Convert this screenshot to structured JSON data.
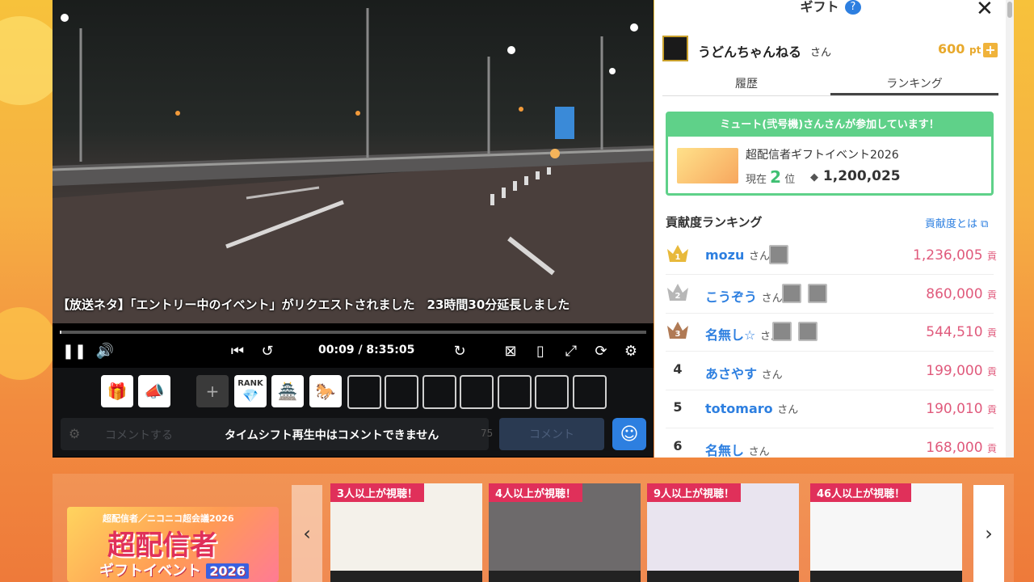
{
  "player": {
    "caption": "【放送ネタ】「エントリー中のイベント」がリクエストされました　23時間30分延長しました",
    "timecode": "00:09 / 8:35:05",
    "progress": 0.0003
  },
  "tools": {
    "rank_label": "RANK"
  },
  "comment": {
    "placeholder": "コメントする",
    "disabled_message": "タイムシフト再生中はコメントできません",
    "char_count": "75",
    "submit_label": "コメント"
  },
  "gift_panel": {
    "title": "ギフト",
    "user_name": "うどんちゃんねる",
    "user_suffix": "さん",
    "points": "600",
    "points_unit": "pt",
    "tabs": [
      "履歴",
      "ランキング"
    ],
    "active_tab": 1,
    "event_header": "ミュート(弐号機)さんさんが参加しています！",
    "event_name": "超配信者ギフトイベント2026",
    "event_rank_prefix": "現在",
    "event_rank": "2",
    "event_rank_suffix": "位",
    "event_score": "1,200,025",
    "contrib_title": "貢献度ランキング",
    "contrib_link": "貢献度とは",
    "score_unit": "貢",
    "rows": [
      {
        "rank": "1",
        "name": "mozu",
        "san": "さん",
        "score": "1,236,005"
      },
      {
        "rank": "2",
        "name": "こうぞう",
        "san": "さん",
        "score": "860,000"
      },
      {
        "rank": "3",
        "name": "名無し☆",
        "san": "さん",
        "score": "544,510"
      },
      {
        "rank": "4",
        "name": "あさやす",
        "san": "さん",
        "score": "199,000"
      },
      {
        "rank": "5",
        "name": "totomaro",
        "san": "さん",
        "score": "190,010"
      },
      {
        "rank": "6",
        "name": "名無し",
        "san": "さん",
        "score": "168,000"
      }
    ],
    "colors": {
      "accent": "#2d7fe0",
      "score": "#e05a7c",
      "event_green": "#5fd189",
      "points": "#e8a92c"
    }
  },
  "carousel": {
    "event_logo": {
      "line1": "超配信者／ニコニコ超会議2026",
      "line2": "超配信者",
      "line3": "ギフトイベント",
      "year": "2026"
    },
    "thumbs": [
      {
        "badge": "3人以上が視聴！"
      },
      {
        "badge": "4人以上が視聴！"
      },
      {
        "badge": "9人以上が視聴！"
      },
      {
        "badge": "46人以上が視聴！"
      }
    ]
  }
}
